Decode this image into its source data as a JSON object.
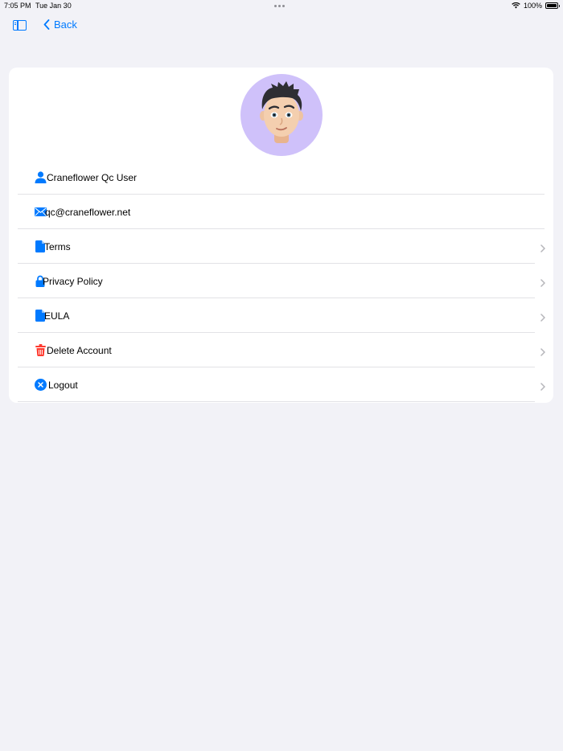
{
  "status_bar": {
    "time": "7:05 PM",
    "date": "Tue Jan 30",
    "battery": "100%"
  },
  "nav": {
    "back_label": "Back"
  },
  "profile": {
    "avatar_icon": "memoji-avatar"
  },
  "rows": [
    {
      "label": "Craneflower Qc User",
      "icon": "person-icon",
      "chevron": false
    },
    {
      "label": "qc@craneflower.net",
      "icon": "envelope-icon",
      "chevron": false
    },
    {
      "label": "Terms",
      "icon": "document-icon",
      "chevron": true
    },
    {
      "label": "Privacy Policy",
      "icon": "lock-icon",
      "chevron": true
    },
    {
      "label": "EULA",
      "icon": "document-icon",
      "chevron": true
    },
    {
      "label": "Delete Account",
      "icon": "trash-icon",
      "chevron": true
    },
    {
      "label": "Logout",
      "icon": "xmark-circle-icon",
      "chevron": true
    }
  ],
  "colors": {
    "accent": "#007aff",
    "destructive": "#ff3b30",
    "background": "#f2f2f7",
    "avatar_bg": "#cfc1fa"
  }
}
